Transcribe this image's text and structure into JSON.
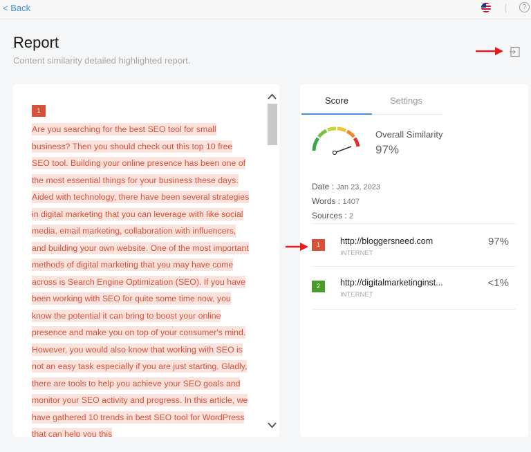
{
  "topbar": {
    "back_label": "< Back",
    "help_label": "?"
  },
  "header": {
    "title": "Report",
    "subtitle": "Content similarity detailed highlighted report."
  },
  "document": {
    "marker": "1",
    "text": "Are you searching for the best SEO tool for small business? Then you should check out this top 10 free SEO tool.   Building your online presence has been one of the most essential things for your business these days. Aided with technology, there have been several strategies in digital marketing that you can leverage with like social media, email marketing, collaboration with influencers, and building your own website.   One of the most important methods of digital marketing that you may have come across is Search Engine Optimization (SEO). If you have been working with SEO for quite some time now, you know the potential it can bring to boost your online presence and make you on top of your consumer's mind.   However, you would also know that working with SEO is not an easy task especially if you are just starting. Gladly, there are tools to help you achieve your SEO goals and monitor your SEO activity and progress.   In this article, we have gathered 10 trends in best SEO tool for WordPress that can help you this"
  },
  "tabs": [
    {
      "label": "Score",
      "active": true
    },
    {
      "label": "Settings",
      "active": false
    }
  ],
  "score": {
    "similarity_label": "Overall Similarity",
    "similarity_value": "97%",
    "gauge_level": 0.97
  },
  "meta": {
    "date_label": "Date :",
    "date_value": "Jan 23, 2023",
    "words_label": "Words :",
    "words_value": "1407",
    "sources_label": "Sources :",
    "sources_value": "2"
  },
  "sources": [
    {
      "index": "1",
      "url": "http://bloggersneed.com",
      "type": "INTERNET",
      "percent": "97%",
      "color": "#d9503a"
    },
    {
      "index": "2",
      "url": "http://digitalmarketinginst...",
      "type": "INTERNET",
      "percent": "<1%",
      "color": "#4a9a2c"
    }
  ],
  "colors": {
    "accent": "#4a90d9",
    "highlight_text": "#d9503a",
    "highlight_bg": "#fbe3dd",
    "annotation_arrow": "#e02020"
  }
}
